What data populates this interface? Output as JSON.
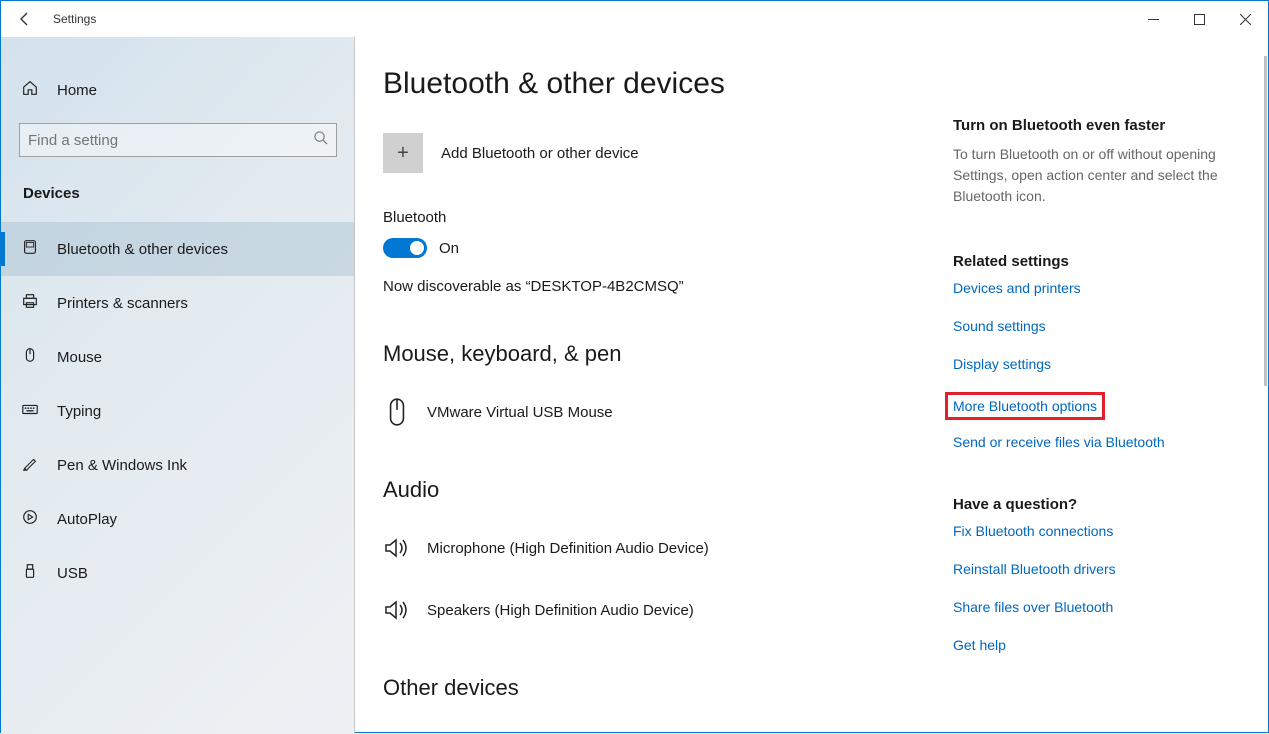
{
  "window": {
    "title": "Settings"
  },
  "sidebar": {
    "home": "Home",
    "search_placeholder": "Find a setting",
    "category": "Devices",
    "items": [
      {
        "label": "Bluetooth & other devices",
        "icon": "bluetooth",
        "active": true
      },
      {
        "label": "Printers & scanners",
        "icon": "printer"
      },
      {
        "label": "Mouse",
        "icon": "mouse"
      },
      {
        "label": "Typing",
        "icon": "keyboard"
      },
      {
        "label": "Pen & Windows Ink",
        "icon": "pen"
      },
      {
        "label": "AutoPlay",
        "icon": "autoplay"
      },
      {
        "label": "USB",
        "icon": "usb"
      }
    ]
  },
  "page": {
    "title": "Bluetooth & other devices",
    "add_device": "Add Bluetooth or other device",
    "bluetooth_label": "Bluetooth",
    "toggle_state": "On",
    "discoverable": "Now discoverable as “DESKTOP-4B2CMSQ”",
    "groups": [
      {
        "title": "Mouse, keyboard, & pen",
        "devices": [
          {
            "name": "VMware Virtual USB Mouse",
            "icon": "mouse"
          }
        ]
      },
      {
        "title": "Audio",
        "devices": [
          {
            "name": "Microphone (High Definition Audio Device)",
            "icon": "speaker"
          },
          {
            "name": "Speakers (High Definition Audio Device)",
            "icon": "speaker"
          }
        ]
      },
      {
        "title": "Other devices",
        "devices": []
      }
    ]
  },
  "right": {
    "tip_heading": "Turn on Bluetooth even faster",
    "tip_text": "To turn Bluetooth on or off without opening Settings, open action center and select the Bluetooth icon.",
    "related_heading": "Related settings",
    "related_links": [
      "Devices and printers",
      "Sound settings",
      "Display settings",
      "More Bluetooth options",
      "Send or receive files via Bluetooth"
    ],
    "question_heading": "Have a question?",
    "question_links": [
      "Fix Bluetooth connections",
      "Reinstall Bluetooth drivers",
      "Share files over Bluetooth",
      "Get help"
    ]
  }
}
